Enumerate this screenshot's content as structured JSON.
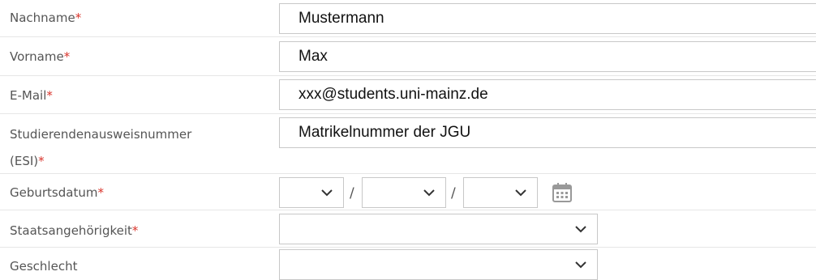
{
  "form": {
    "required_marker": "*",
    "fields": {
      "nachname": {
        "label": "Nachname",
        "value": "Mustermann"
      },
      "vorname": {
        "label": "Vorname",
        "value": "Max"
      },
      "email": {
        "label": "E-Mail",
        "value": "xxx@students.uni-mainz.de"
      },
      "esi": {
        "label_line1": "Studierendenausweisnummer",
        "label_line2": "(ESI)",
        "value": "Matrikelnummer der JGU"
      },
      "geburtsdatum": {
        "label": "Geburtsdatum",
        "day": "",
        "month": "",
        "year": "",
        "separator": "/"
      },
      "staatsangehoerigkeit": {
        "label": "Staatsangehörigkeit",
        "value": ""
      },
      "geschlecht": {
        "label": "Geschlecht",
        "value": ""
      }
    }
  },
  "icons": {
    "dropdown": "chevron-down-icon",
    "calendar": "calendar-icon"
  },
  "colors": {
    "label": "#555555",
    "required": "#d9342b",
    "border": "#c8c8c8",
    "divider": "#e6e6e6",
    "icon": "#999999"
  }
}
